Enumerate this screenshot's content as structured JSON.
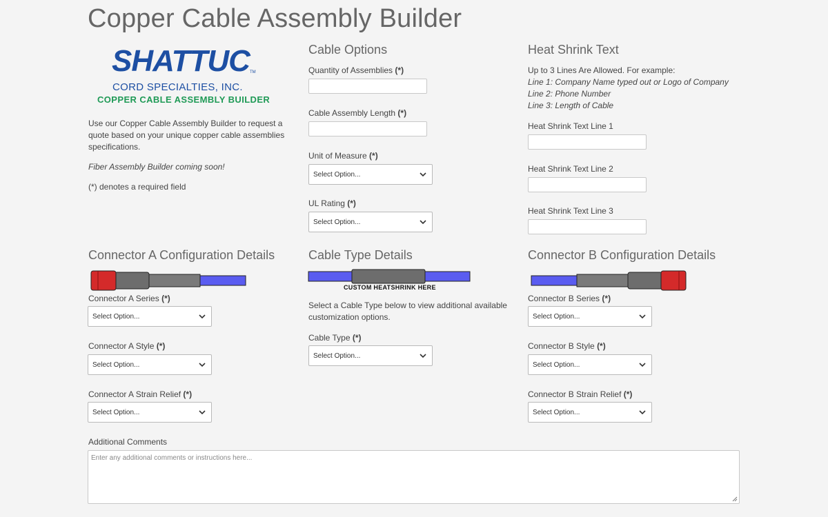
{
  "page": {
    "title": "Copper Cable Assembly Builder"
  },
  "logo": {
    "wordmark": "SHATTUC",
    "tm": "TM",
    "line1": "CORD SPECIALTIES, INC.",
    "line2": "COPPER CABLE ASSEMBLY BUILDER"
  },
  "intro": {
    "description": "Use our Copper Cable Assembly Builder to request a quote based on your unique copper cable assemblies specifications.",
    "fiber_note": "Fiber Assembly Builder coming soon!",
    "required_note": "(*) denotes a required field"
  },
  "cable_options": {
    "heading": "Cable Options",
    "quantity_label": "Quantity of Assemblies",
    "length_label": "Cable Assembly Length",
    "unit_label": "Unit of Measure",
    "unit_value": "Select Option...",
    "ul_label": "UL Rating",
    "ul_value": "Select Option..."
  },
  "heat_shrink": {
    "heading": "Heat Shrink Text",
    "intro": "Up to 3 Lines Are Allowed. For example:",
    "example1": "Line 1: Company Name typed out or Logo of Company",
    "example2": "Line 2: Phone Number",
    "example3": "Line 3: Length of Cable",
    "line1_label": "Heat Shrink Text Line 1",
    "line2_label": "Heat Shrink Text Line 2",
    "line3_label": "Heat Shrink Text Line 3"
  },
  "connector_a": {
    "heading": "Connector A Configuration Details",
    "series_label": "Connector A Series",
    "series_value": "Select Option...",
    "style_label": "Connector A Style",
    "style_value": "Select Option...",
    "relief_label": "Connector A Strain Relief",
    "relief_value": "Select Option..."
  },
  "cable_type": {
    "heading": "Cable Type Details",
    "heatshrink_caption": "CUSTOM HEATSHRINK HERE",
    "description": "Select a Cable Type below to view additional available customization options.",
    "type_label": "Cable Type",
    "type_value": "Select Option..."
  },
  "connector_b": {
    "heading": "Connector B Configuration Details",
    "series_label": "Connector B Series",
    "series_value": "Select Option...",
    "style_label": "Connector B Style",
    "style_value": "Select Option...",
    "relief_label": "Connector B Strain Relief",
    "relief_value": "Select Option..."
  },
  "comments": {
    "label": "Additional Comments",
    "placeholder": "Enter any additional comments or instructions here..."
  },
  "required_marker": "(*)",
  "icons": {
    "select_arrow": "chevron-down-icon",
    "resize": "resize-grip-icon"
  },
  "colors": {
    "logo_blue": "#1d4fa3",
    "logo_green": "#1f9a56",
    "cable_blue": "#5a5cf0",
    "connector_red": "#d42a2a"
  }
}
